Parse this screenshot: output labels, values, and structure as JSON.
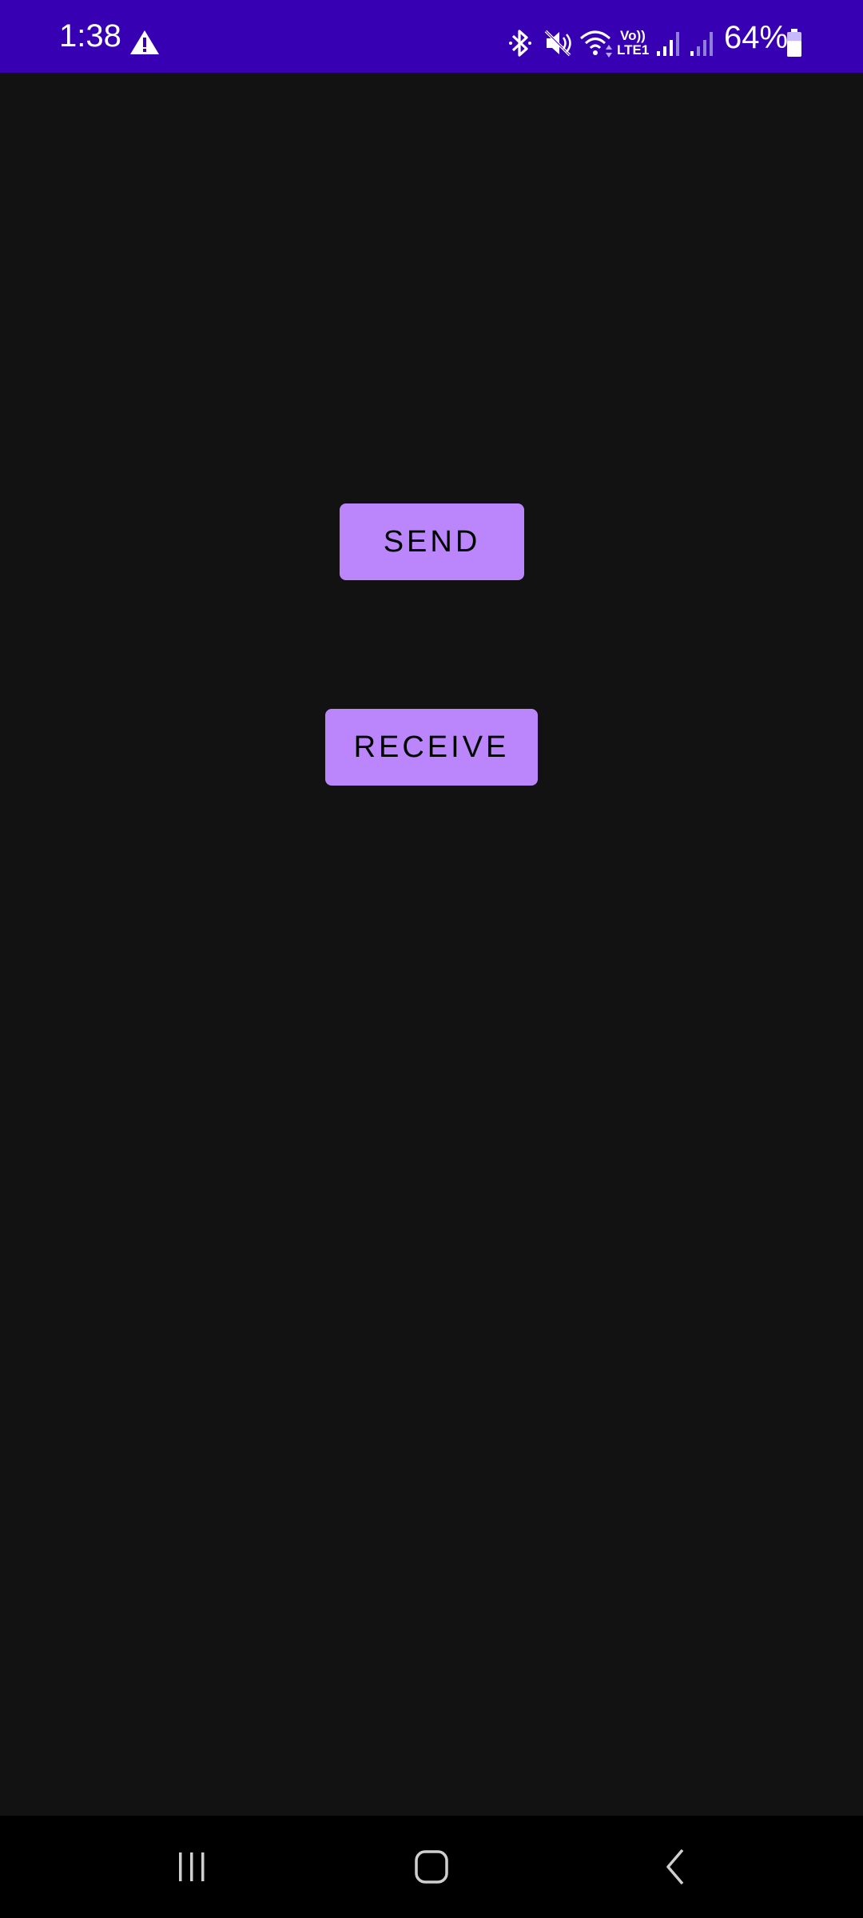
{
  "status_bar": {
    "time": "1:38",
    "battery_percent": "64%",
    "battery_level": 0.64,
    "volte_line1": "Vo))",
    "volte_line2": "LTE1",
    "background_color": "#3700b3",
    "icons": [
      "warning-icon",
      "bluetooth-icon",
      "mute-icon",
      "wifi-icon",
      "signal-icon",
      "signal-icon",
      "battery-icon"
    ]
  },
  "main": {
    "send_label": "SEND",
    "receive_label": "RECEIVE",
    "button_color": "#bb86fc",
    "background_color": "#121212"
  },
  "nav_bar": {
    "icons": [
      "recents-icon",
      "home-icon",
      "back-icon"
    ]
  }
}
